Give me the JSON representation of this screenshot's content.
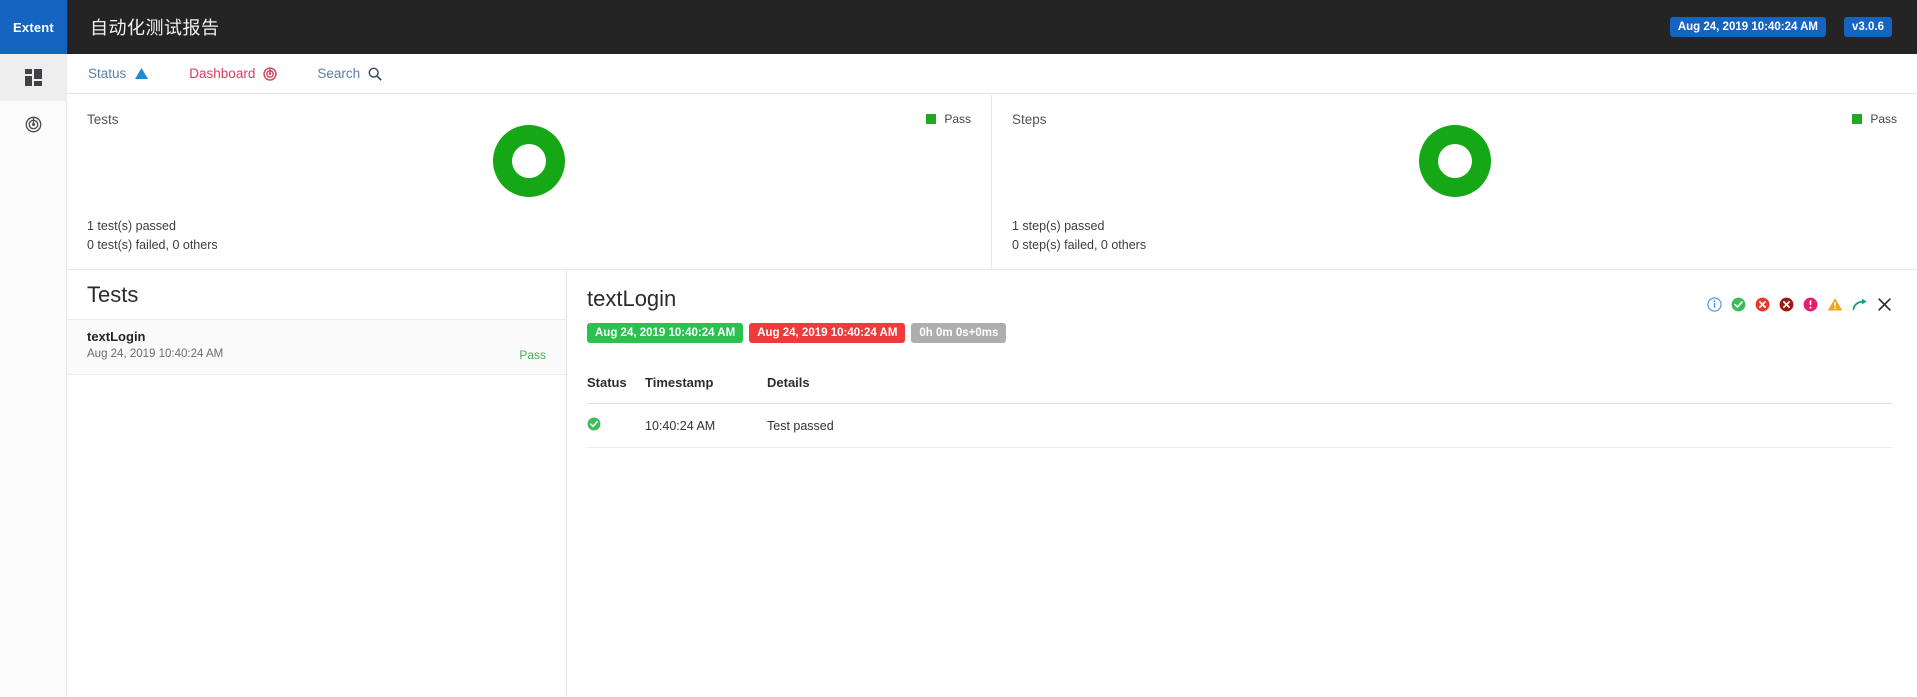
{
  "topbar": {
    "logo": "Extent",
    "title": "自动化测试报告",
    "timestamp_badge": "Aug 24, 2019 10:40:24 AM",
    "version_badge": "v3.0.6"
  },
  "rail": {
    "items": [
      {
        "name": "dashboard-grid",
        "icon": "grid-icon",
        "active": true
      },
      {
        "name": "target",
        "icon": "radar-icon",
        "active": false
      }
    ]
  },
  "nav": {
    "items": [
      {
        "label": "Status",
        "icon": "triangle-up-icon"
      },
      {
        "label": "Dashboard",
        "icon": "radar-icon"
      },
      {
        "label": "Search",
        "icon": "search-icon"
      }
    ]
  },
  "cards": [
    {
      "label": "Tests",
      "legend": "Pass",
      "line1": "1 test(s) passed",
      "line2": "0 test(s) failed, 0 others"
    },
    {
      "label": "Steps",
      "legend": "Pass",
      "line1": "1 step(s) passed",
      "line2": "0 step(s) failed, 0 others"
    }
  ],
  "tests_pane": {
    "header": "Tests",
    "rows": [
      {
        "name": "textLogin",
        "timestamp": "Aug 24, 2019 10:40:24 AM",
        "status": "Pass"
      }
    ]
  },
  "detail": {
    "title": "textLogin",
    "chip_start": "Aug 24, 2019 10:40:24 AM",
    "chip_end": "Aug 24, 2019 10:40:24 AM",
    "chip_duration": "0h 0m 0s+0ms",
    "icons": [
      "info-icon",
      "check-circle-icon",
      "cross-circle-icon",
      "cross-circle-dark-icon",
      "exclamation-circle-icon",
      "warning-triangle-icon",
      "skip-arrow-icon",
      "close-icon"
    ],
    "table": {
      "columns": [
        "Status",
        "Timestamp",
        "Details"
      ],
      "rows": [
        {
          "status": "pass",
          "timestamp": "10:40:24 AM",
          "details": "Test passed"
        }
      ]
    }
  },
  "colors": {
    "brand_blue": "#1565c0",
    "topbar_dark": "#242424",
    "pass_green": "#16a716",
    "chip_green": "#2bc14f",
    "chip_red": "#ef3b3b",
    "chip_gray": "#aeaeae",
    "dashboard_crimson": "#d43f5c"
  },
  "chart_data": [
    {
      "type": "pie",
      "title": "Tests",
      "categories": [
        "Pass"
      ],
      "values": [
        1
      ],
      "colors": [
        "#16a716"
      ],
      "legend": [
        "Pass"
      ],
      "legend_position": "top-right",
      "donut": true,
      "annotations": [
        "1 test(s) passed",
        "0 test(s) failed, 0 others"
      ]
    },
    {
      "type": "pie",
      "title": "Steps",
      "categories": [
        "Pass"
      ],
      "values": [
        1
      ],
      "colors": [
        "#16a716"
      ],
      "legend": [
        "Pass"
      ],
      "legend_position": "top-right",
      "donut": true,
      "annotations": [
        "1 step(s) passed",
        "0 step(s) failed, 0 others"
      ]
    }
  ]
}
